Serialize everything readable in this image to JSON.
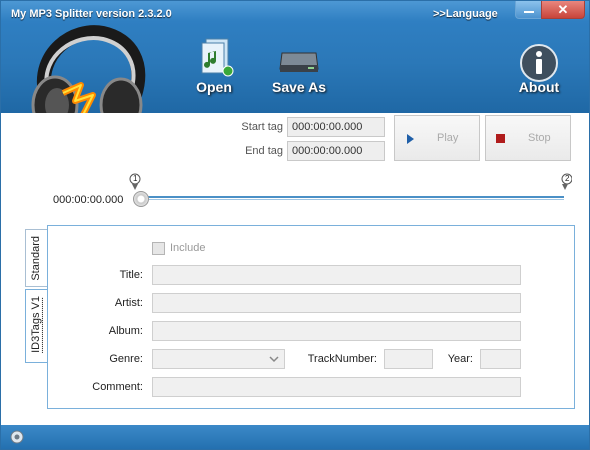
{
  "window": {
    "title": "My MP3 Splitter version 2.3.2.0",
    "language_link": ">>Language",
    "close_glyph": "✕"
  },
  "toolbar": {
    "open_label": "Open",
    "save_as_label": "Save As",
    "about_label": "About"
  },
  "playback": {
    "start_tag_label": "Start tag",
    "start_tag_value": "000:00:00.000",
    "end_tag_label": "End tag",
    "end_tag_value": "000:00:00.000",
    "play_label": "Play",
    "stop_label": "Stop",
    "position_label": "000:00:00.000",
    "marker1": "1",
    "marker2": "2"
  },
  "tabs": {
    "standard": "Standard",
    "id3": "ID3Tags V1"
  },
  "form": {
    "include_label": "Include",
    "title_label": "Title:",
    "artist_label": "Artist:",
    "album_label": "Album:",
    "genre_label": "Genre:",
    "track_label": "TrackNumber:",
    "year_label": "Year:",
    "comment_label": "Comment:"
  },
  "colors": {
    "header": "#2b78b8",
    "accent": "#4b90c6",
    "stop_icon": "#b01c1c",
    "play_icon": "#1f5fa8"
  }
}
